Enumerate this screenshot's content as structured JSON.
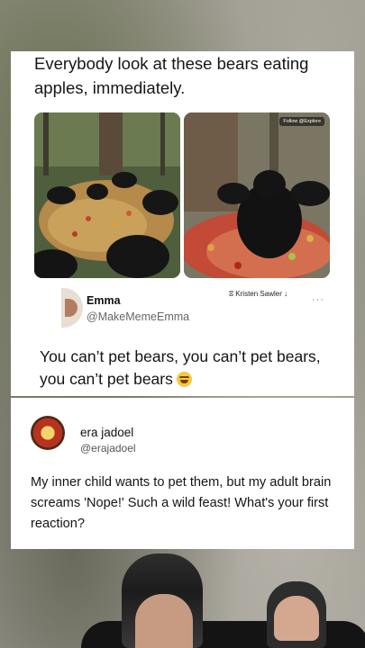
{
  "post": {
    "title": "Everybody look at these bears eating apples, immediately.",
    "images": [
      {
        "description_icon": "bears-apples-photo-1"
      },
      {
        "description_icon": "bears-apples-photo-2",
        "overlay": "Follow @Explore"
      }
    ],
    "author": {
      "name": "Emma",
      "handle": "@MakeMemeEmma"
    },
    "credit": "ⵓ Kristen Sawler ↓",
    "more": "···",
    "text": "You can’t pet bears, you can’t pet bears, you can’t pet bears"
  },
  "reply": {
    "name": "era jadoel",
    "handle": "@erajadoel",
    "text": "My inner child wants to pet them, but my adult brain screams 'Nope!' Such a wild feast! What's your first reaction?"
  },
  "colors": {
    "card": "#ffffff",
    "text": "#141414",
    "handle": "#666666"
  }
}
